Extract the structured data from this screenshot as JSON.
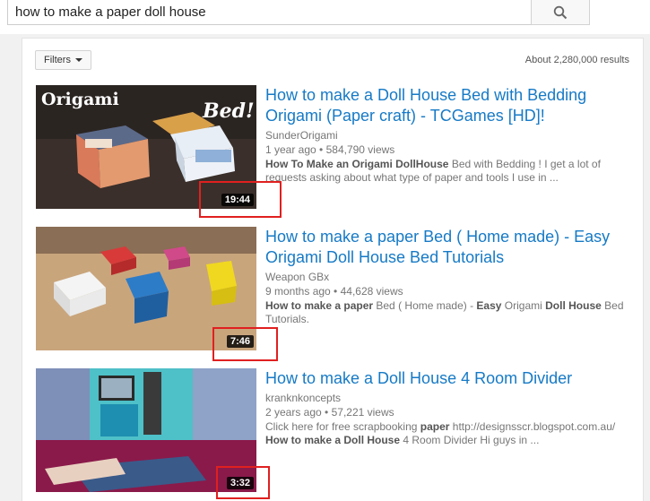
{
  "search": {
    "query": "how to make a paper doll house"
  },
  "toolbar": {
    "filters_label": "Filters",
    "results_count": "About 2,280,000 results"
  },
  "results": [
    {
      "title": "How to make a Doll House Bed with Bedding Origami (Paper craft) - TCGames [HD]!",
      "channel": "SunderOrigami",
      "age": "1 year ago",
      "views": "584,790 views",
      "desc": [
        {
          "t": "How To Make an Origami DollHouse",
          "b": true
        },
        {
          "t": " Bed with Bedding ! I get a lot of requests asking about what type of paper and tools I use in ...",
          "b": false
        }
      ],
      "duration": "19:44",
      "thumb_text_left": "Origami",
      "thumb_text_right": "Bed!"
    },
    {
      "title": "How to make a paper Bed ( Home made) - Easy Origami Doll House Bed Tutorials",
      "channel": "Weapon GBx",
      "age": "9 months ago",
      "views": "44,628 views",
      "desc": [
        {
          "t": "How to make a paper",
          "b": true
        },
        {
          "t": " Bed ( Home made) - ",
          "b": false
        },
        {
          "t": "Easy",
          "b": true
        },
        {
          "t": " Origami ",
          "b": false
        },
        {
          "t": "Doll House",
          "b": true
        },
        {
          "t": " Bed Tutorials.",
          "b": false
        }
      ],
      "duration": "7:46"
    },
    {
      "title": "How to make a Doll House 4 Room Divider",
      "channel": "kranknkoncepts",
      "age": "2 years ago",
      "views": "57,221 views",
      "desc": [
        {
          "t": "Click here for free scrapbooking ",
          "b": false
        },
        {
          "t": "paper",
          "b": true
        },
        {
          "t": " http://designsscr.blogspot.com.au/ ",
          "b": false
        },
        {
          "t": "How to make a Doll House",
          "b": true
        },
        {
          "t": " 4 Room Divider Hi guys in ...",
          "b": false
        }
      ],
      "duration": "3:32"
    }
  ],
  "colors": {
    "link": "#167ac6",
    "annotation": "#e02020"
  }
}
